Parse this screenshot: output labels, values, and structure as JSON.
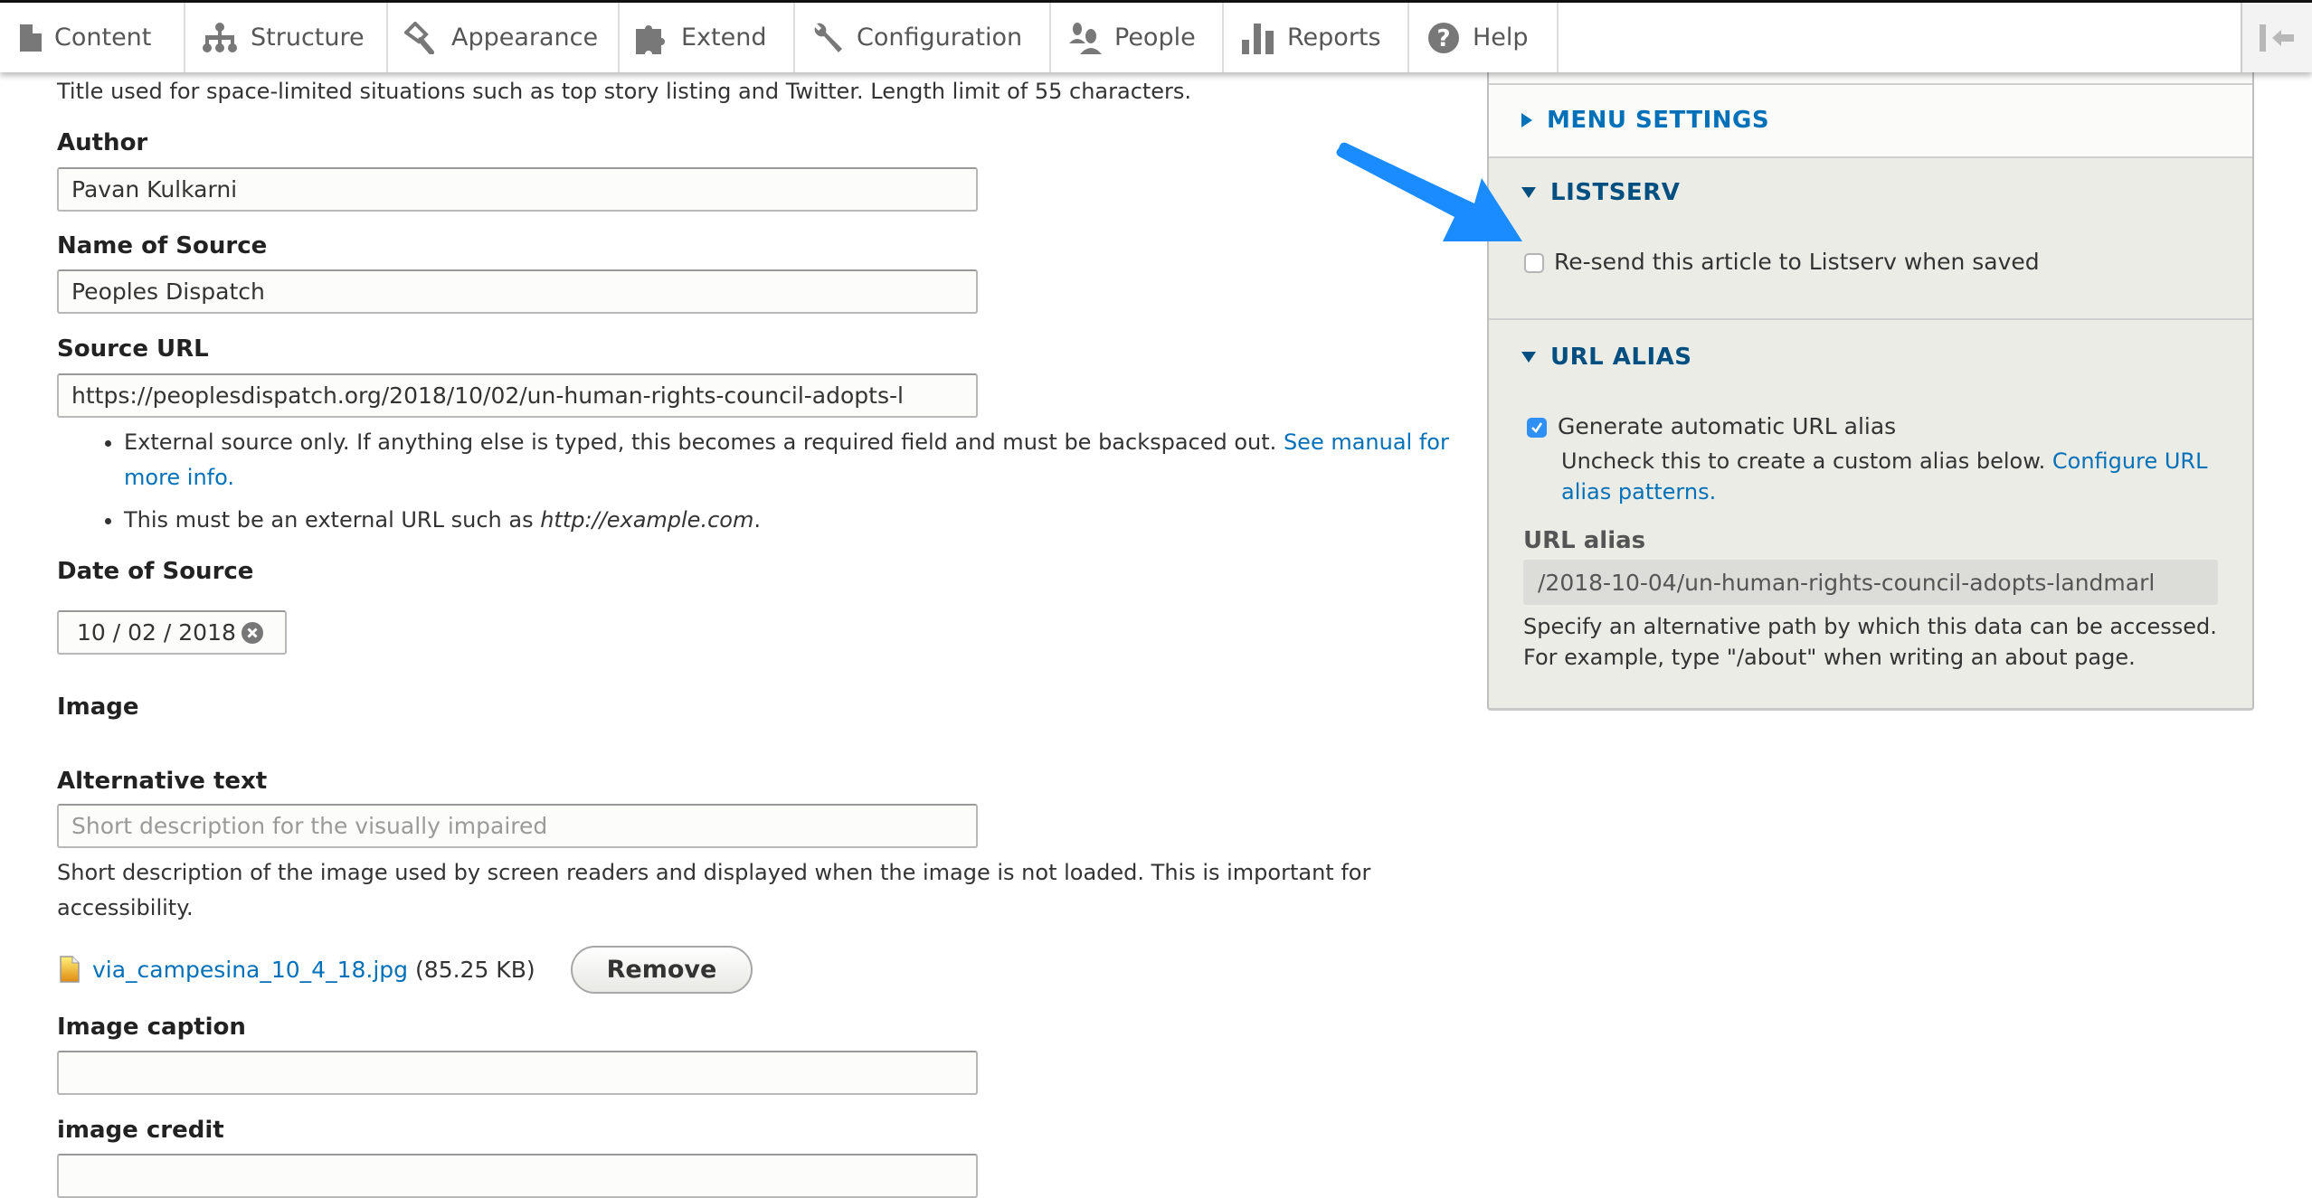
{
  "toolbar": {
    "items": [
      {
        "label": "Content",
        "icon": "file-icon"
      },
      {
        "label": "Structure",
        "icon": "hierarchy-icon"
      },
      {
        "label": "Appearance",
        "icon": "paint-brush-icon"
      },
      {
        "label": "Extend",
        "icon": "puzzle-icon"
      },
      {
        "label": "Configuration",
        "icon": "wrench-icon"
      },
      {
        "label": "People",
        "icon": "people-icon"
      },
      {
        "label": "Reports",
        "icon": "bar-chart-icon"
      },
      {
        "label": "Help",
        "icon": "help-icon"
      }
    ],
    "collapse_icon": "collapse-left-icon"
  },
  "form": {
    "title_help": "Title used for space-limited situations such as top story listing and Twitter. Length limit of 55 characters.",
    "author": {
      "label": "Author",
      "value": "Pavan Kulkarni"
    },
    "source_name": {
      "label": "Name of Source",
      "value": "Peoples Dispatch"
    },
    "source_url": {
      "label": "Source URL",
      "value": "https://peoplesdispatch.org/2018/10/02/un-human-rights-council-adopts-l",
      "help1_text": "External source only. If anything else is typed, this becomes a required field and must be backspaced out. ",
      "help1_link": "See manual for more info.",
      "help2_text": "This must be an external URL such as ",
      "help2_example": "http://example.com",
      "help2_end": "."
    },
    "date_of_source": {
      "label": "Date of Source",
      "value": "10 / 02 / 2018"
    },
    "image": {
      "label": "Image",
      "alt_label": "Alternative text",
      "alt_placeholder": "Short description for the visually impaired",
      "alt_help": "Short description of the image used by screen readers and displayed when the image is not loaded. This is important for accessibility.",
      "file_name": "via_campesina_10_4_18.jpg",
      "file_size": "(85.25 KB)",
      "remove_label": "Remove"
    },
    "image_caption": {
      "label": "Image caption",
      "value": ""
    },
    "image_credit": {
      "label": "image credit",
      "value": ""
    }
  },
  "sidebar": {
    "menu_settings": {
      "title": "MENU SETTINGS",
      "expanded": false
    },
    "listserv": {
      "title": "LISTSERV",
      "expanded": true,
      "checkbox_label": "Re-send this article to Listserv when saved",
      "checked": false
    },
    "url_alias": {
      "title": "URL ALIAS",
      "expanded": true,
      "auto_label": "Generate automatic URL alias",
      "auto_checked": true,
      "auto_help": "Uncheck this to create a custom alias below. ",
      "auto_help_link": "Configure URL alias patterns.",
      "alias_label": "URL alias",
      "alias_value": "/2018-10-04/un-human-rights-council-adopts-landmarl",
      "alias_help": "Specify an alternative path by which this data can be accessed. For example, type \"/about\" when writing an about page."
    }
  },
  "annotation": {
    "type": "arrow",
    "color": "#1a8cff",
    "points_to": "listserv-checkbox"
  }
}
